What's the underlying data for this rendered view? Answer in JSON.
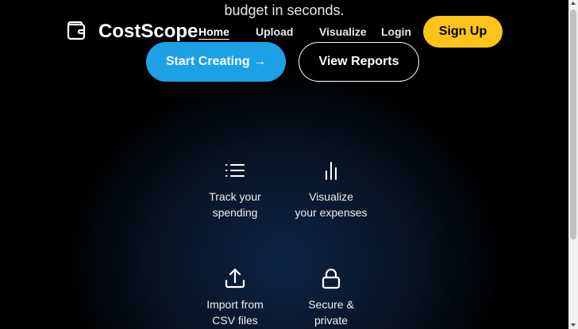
{
  "hero": {
    "tagline": "budget in seconds.",
    "primary_button": "Start Creating →",
    "secondary_button": "View Reports"
  },
  "header": {
    "brand": "CostScope",
    "logo_icon": "wallet-icon",
    "nav": [
      {
        "label": "Home",
        "active": true
      },
      {
        "label": "Upload"
      },
      {
        "label": "Visualize"
      },
      {
        "label": "Login"
      }
    ],
    "signup": "Sign Up"
  },
  "features": [
    {
      "icon": "list-icon",
      "line1": "Track your",
      "line2": "spending"
    },
    {
      "icon": "bar-chart-icon",
      "line1": "Visualize",
      "line2": "your expenses"
    },
    {
      "icon": "upload-icon",
      "line1": "Import from",
      "line2": "CSV files"
    },
    {
      "icon": "lock-icon",
      "line1": "Secure &",
      "line2": "private"
    }
  ],
  "colors": {
    "accent_yellow": "#fcc419",
    "accent_blue": "#1da1e6",
    "background": "#000000"
  }
}
